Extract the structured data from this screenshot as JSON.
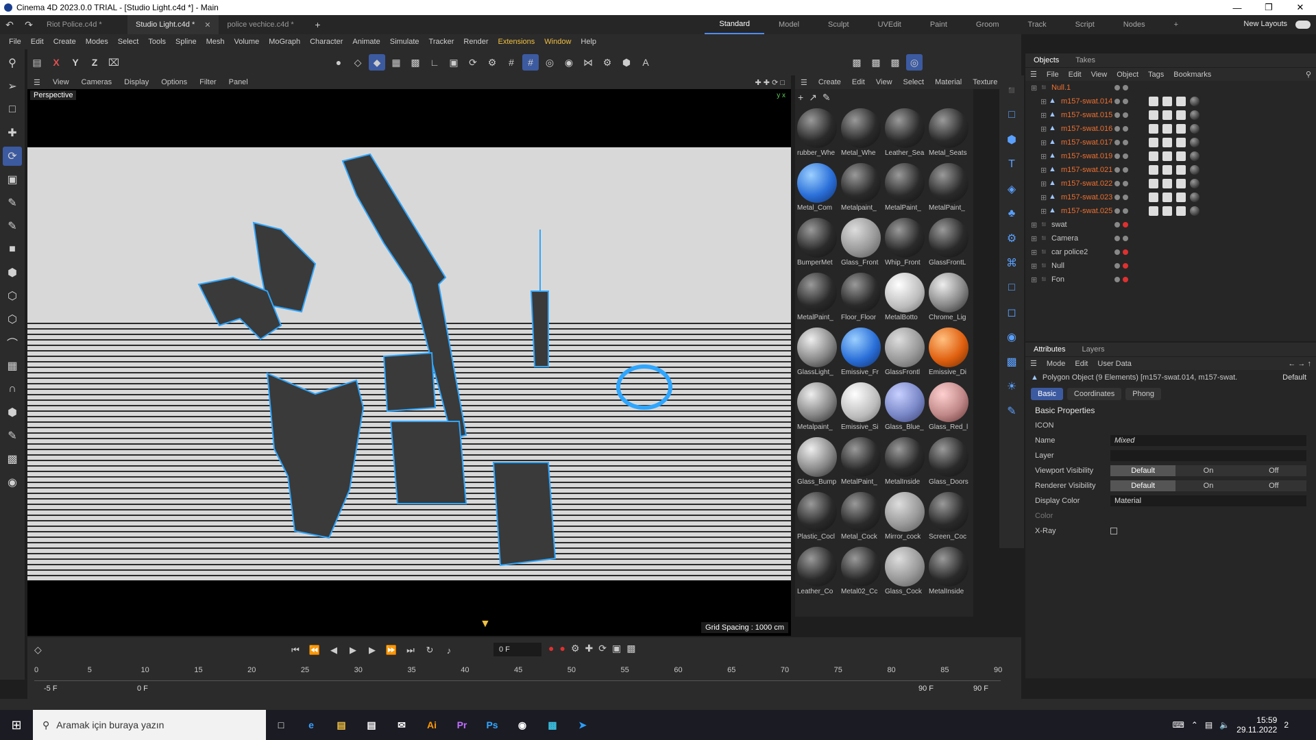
{
  "window": {
    "title": "Cinema 4D 2023.0.0 TRIAL - [Studio Light.c4d *] - Main"
  },
  "tabs": [
    {
      "label": "Riot Police.c4d *"
    },
    {
      "label": "Studio Light.c4d *"
    },
    {
      "label": "police vechice.c4d *"
    }
  ],
  "layouts": [
    "Standard",
    "Model",
    "Sculpt",
    "UVEdit",
    "Paint",
    "Groom",
    "Track",
    "Script",
    "Nodes"
  ],
  "new_layouts": "New Layouts",
  "menu": [
    "File",
    "Edit",
    "Create",
    "Modes",
    "Select",
    "Tools",
    "Spline",
    "Mesh",
    "Volume",
    "MoGraph",
    "Character",
    "Animate",
    "Simulate",
    "Tracker",
    "Render",
    "Extensions",
    "Window",
    "Help"
  ],
  "viewport": {
    "menu": [
      "View",
      "Cameras",
      "Display",
      "Options",
      "Filter",
      "Panel"
    ],
    "camera_label": "Perspective",
    "grid_spacing": "Grid Spacing : 1000 cm"
  },
  "material_menu": [
    "Create",
    "Edit",
    "View",
    "Select",
    "Material",
    "Texture"
  ],
  "materials": [
    {
      "name": "rubber_Whe",
      "style": "dark"
    },
    {
      "name": "Metal_Whe",
      "style": "dark"
    },
    {
      "name": "Leather_Sea",
      "style": "dark"
    },
    {
      "name": "Metal_Seats",
      "style": "dark"
    },
    {
      "name": "Metal_Com",
      "style": "blue"
    },
    {
      "name": "Metalpaint_",
      "style": "dark"
    },
    {
      "name": "MetalPaint_",
      "style": "dark"
    },
    {
      "name": "MetalPaint_",
      "style": "dark"
    },
    {
      "name": "BumperMet",
      "style": "dark"
    },
    {
      "name": "Glass_Front",
      "style": "glass"
    },
    {
      "name": "Whip_Front",
      "style": "dark"
    },
    {
      "name": "GlassFrontL",
      "style": "dark"
    },
    {
      "name": "MetalPaint_",
      "style": "dark"
    },
    {
      "name": "Floor_Floor",
      "style": "dark"
    },
    {
      "name": "MetalBotto",
      "style": "white"
    },
    {
      "name": "Chrome_Lig",
      "style": "check"
    },
    {
      "name": "GlassLight_",
      "style": "check"
    },
    {
      "name": "Emissive_Fr",
      "style": "blue"
    },
    {
      "name": "GlassFrontl",
      "style": "glass"
    },
    {
      "name": "Emissive_Di",
      "style": "orange"
    },
    {
      "name": "Metalpaint_",
      "style": "check"
    },
    {
      "name": "Emissive_Si",
      "style": "white"
    },
    {
      "name": "Glass_Blue_",
      "style": "gblue"
    },
    {
      "name": "Glass_Red_l",
      "style": "gred"
    },
    {
      "name": "Glass_Bump",
      "style": "check"
    },
    {
      "name": "MetalPaint_",
      "style": "dark"
    },
    {
      "name": "MetalInside",
      "style": "dark"
    },
    {
      "name": "Glass_Doors",
      "style": "dark"
    },
    {
      "name": "Plastic_Cocl",
      "style": "dark"
    },
    {
      "name": "Metal_Cock",
      "style": "dark"
    },
    {
      "name": "Mirror_cock",
      "style": "glass"
    },
    {
      "name": "Screen_Coc",
      "style": "dark"
    },
    {
      "name": "Leather_Co",
      "style": "dark"
    },
    {
      "name": "Metal02_Cc",
      "style": "dark"
    },
    {
      "name": "Glass_Cock",
      "style": "glass"
    },
    {
      "name": "MetalInside",
      "style": "dark"
    }
  ],
  "objects_panel": {
    "tabs": [
      "Objects",
      "Takes"
    ],
    "menu": [
      "File",
      "Edit",
      "View",
      "Object",
      "Tags",
      "Bookmarks"
    ],
    "items": [
      {
        "name": "Null.1",
        "level": 0,
        "highlight": true,
        "dot": "gray"
      },
      {
        "name": "m157-swat.014",
        "level": 1,
        "highlight": true,
        "dot": "gray"
      },
      {
        "name": "m157-swat.015",
        "level": 1,
        "highlight": true,
        "dot": "gray"
      },
      {
        "name": "m157-swat.016",
        "level": 1,
        "highlight": true,
        "dot": "gray"
      },
      {
        "name": "m157-swat.017",
        "level": 1,
        "highlight": true,
        "dot": "gray"
      },
      {
        "name": "m157-swat.019",
        "level": 1,
        "highlight": true,
        "dot": "gray"
      },
      {
        "name": "m157-swat.021",
        "level": 1,
        "highlight": true,
        "dot": "gray"
      },
      {
        "name": "m157-swat.022",
        "level": 1,
        "highlight": true,
        "dot": "gray"
      },
      {
        "name": "m157-swat.023",
        "level": 1,
        "highlight": true,
        "dot": "gray"
      },
      {
        "name": "m157-swat.025",
        "level": 1,
        "highlight": true,
        "dot": "gray"
      },
      {
        "name": "swat",
        "level": 0,
        "highlight": false,
        "dot": "red"
      },
      {
        "name": "Camera",
        "level": 0,
        "highlight": false,
        "dot": "gray"
      },
      {
        "name": "car police2",
        "level": 0,
        "highlight": false,
        "dot": "red"
      },
      {
        "name": "Null",
        "level": 0,
        "highlight": false,
        "dot": "red"
      },
      {
        "name": "Fon",
        "level": 0,
        "highlight": false,
        "dot": "red"
      }
    ]
  },
  "attributes_panel": {
    "tabs": [
      "Attributes",
      "Layers"
    ],
    "menu": [
      "Mode",
      "Edit",
      "User Data"
    ],
    "object_line": "Polygon Object (9 Elements) [m157-swat.014, m157-swat.",
    "preset": "Default",
    "subtabs": [
      "Basic",
      "Coordinates",
      "Phong"
    ],
    "section": "Basic Properties",
    "icon_label": "ICON",
    "name_label": "Name",
    "name_value": "Mixed",
    "layer_label": "Layer",
    "viewport_vis_label": "Viewport Visibility",
    "renderer_vis_label": "Renderer Visibility",
    "vis_options": [
      "Default",
      "On",
      "Off"
    ],
    "display_color_label": "Display Color",
    "display_color_value": "Material",
    "color_label": "Color",
    "xray_label": "X-Ray"
  },
  "timeline": {
    "current_frame": "0 F",
    "ruler_ticks": [
      "0",
      "5",
      "10",
      "15",
      "20",
      "25",
      "30",
      "35",
      "40",
      "45",
      "50",
      "55",
      "60",
      "65",
      "70",
      "75",
      "80",
      "85",
      "90"
    ],
    "range_start": "-5 F",
    "range_min": "0 F",
    "range_max": "90 F",
    "range_end": "90 F"
  },
  "taskbar": {
    "search_placeholder": "Aramak için buraya yazın",
    "apps": [
      "Ai",
      "Pr",
      "Ps"
    ],
    "time": "15:59",
    "date": "29.11.2022",
    "notif_count": "2"
  }
}
